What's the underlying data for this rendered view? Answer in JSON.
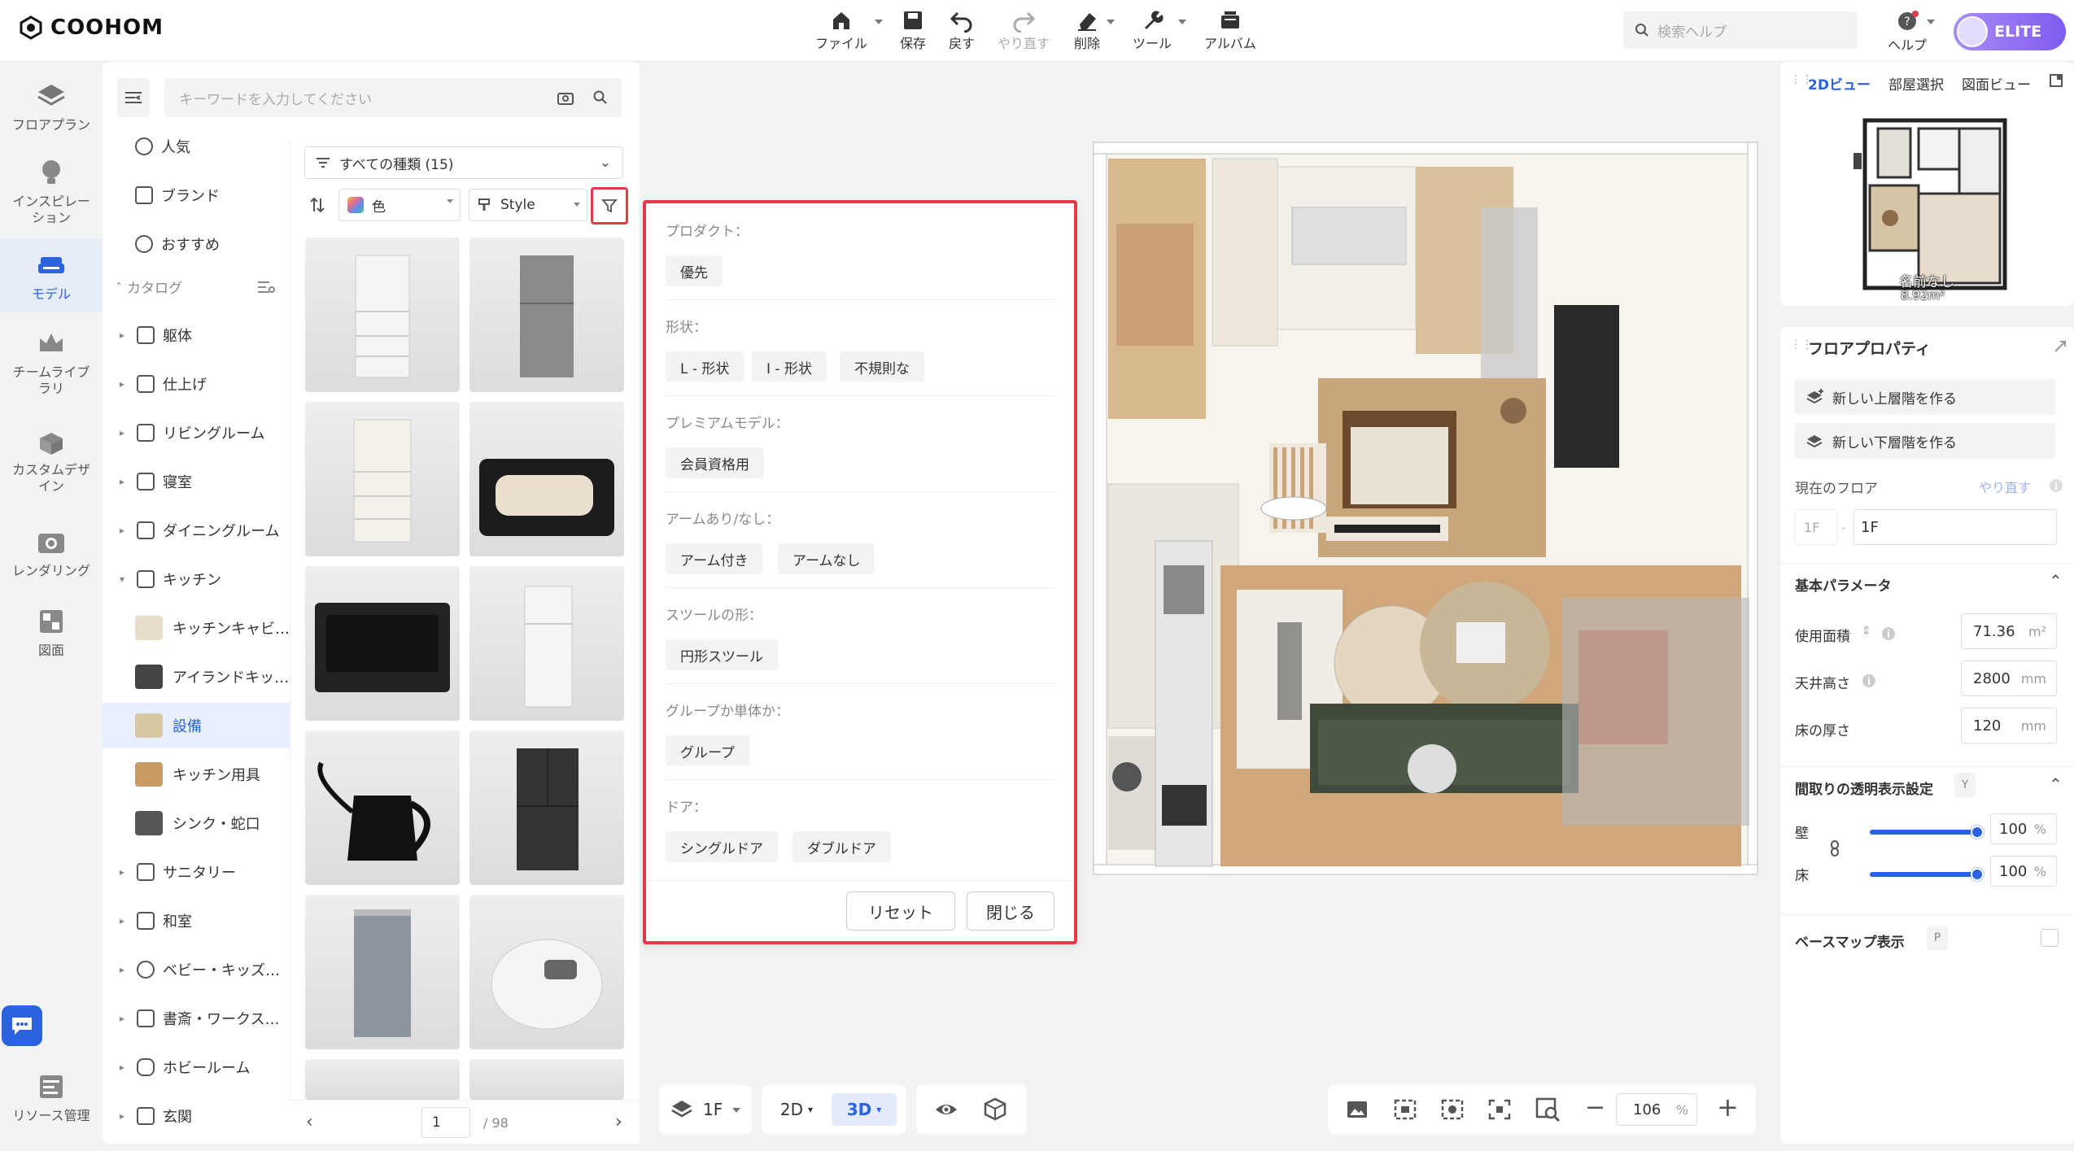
{
  "app": {
    "logo_text": "COOHOM"
  },
  "toolbar": {
    "file": "ファイル",
    "save": "保存",
    "undo": "戻す",
    "redo": "やり直す",
    "delete": "削除",
    "tools": "ツール",
    "album": "アルバム"
  },
  "header": {
    "search_placeholder": "検索ヘルプ",
    "help": "ヘルプ",
    "badge": "ELITE"
  },
  "leftnav": [
    {
      "label": "フロアプラン"
    },
    {
      "label": "インスピレー\nション"
    },
    {
      "label": "モデル"
    },
    {
      "label": "チームライブ\nラリ"
    },
    {
      "label": "カスタムデザ\nイン"
    },
    {
      "label": "レンダリング"
    },
    {
      "label": "図面"
    },
    {
      "label": "リソース管理"
    }
  ],
  "catalog": {
    "search_placeholder": "キーワードを入力してください",
    "top_items": [
      "人気",
      "ブランド",
      "おすすめ"
    ],
    "section": "カタログ",
    "items": [
      "躯体",
      "仕上げ",
      "リビングルーム",
      "寝室",
      "ダイニングルーム",
      "キッチン"
    ],
    "kitchen_sub": [
      "キッチンキャビ…",
      "アイランドキッ…",
      "設備",
      "キッチン用具",
      "シンク・蛇口"
    ],
    "items2": [
      "サニタリー",
      "和室",
      "ベビー・キッズ…",
      "書斎・ワークス…",
      "ホビールーム",
      "玄関"
    ],
    "type_select": "すべての種類 (15)",
    "color_select": "色",
    "style_select": "Style",
    "page_current": "1",
    "page_total": "/ 98"
  },
  "filter": {
    "sections": [
      {
        "title": "プロダクト：",
        "chips": [
          "優先"
        ]
      },
      {
        "title": "形状：",
        "chips": [
          "L - 形状",
          "I - 形状",
          "不規則な"
        ]
      },
      {
        "title": "プレミアムモデル：",
        "chips": [
          "会員資格用"
        ]
      },
      {
        "title": "アームあり/なし：",
        "chips": [
          "アーム付き",
          "アームなし"
        ]
      },
      {
        "title": "スツールの形：",
        "chips": [
          "円形スツール"
        ]
      },
      {
        "title": "グループか単体か：",
        "chips": [
          "グループ"
        ]
      },
      {
        "title": "ドア：",
        "chips": [
          "シングルドア",
          "ダブルドア"
        ]
      }
    ],
    "reset": "リセット",
    "close": "閉じる"
  },
  "bottombar": {
    "floor": "1F",
    "view2d": "2D",
    "view3d": "3D",
    "zoom": "106",
    "zoom_unit": "%"
  },
  "right": {
    "tabs": [
      "2Dビュー",
      "部屋選択",
      "図面ビュー"
    ],
    "minimap_name": "名前なし",
    "minimap_area": "8.92m²",
    "floor_props": "フロアプロパティ",
    "new_upper": "新しい上層階を作る",
    "new_lower": "新しい下層階を作る",
    "current_floor": "現在のフロア",
    "redo_link": "やり直す",
    "floor_prefix": "1F",
    "floor_value": "1F",
    "basic_params": "基本パラメータ",
    "area_label": "使用面積",
    "area_value": "71.36",
    "area_unit": "m²",
    "ceiling_label": "天井高さ",
    "ceiling_value": "2800",
    "ceiling_unit": "mm",
    "floor_thick_label": "床の厚さ",
    "floor_thick_value": "120",
    "floor_thick_unit": "mm",
    "transparency": "間取りの透明表示設定",
    "transparency_key": "Y",
    "wall_label": "壁",
    "wall_value": "100",
    "wall_level": 1.0,
    "floor_label": "床",
    "floor_level_value": "100",
    "floor_level": 1.0,
    "pct": "%",
    "basemap": "ベースマップ表示",
    "basemap_key": "P"
  }
}
